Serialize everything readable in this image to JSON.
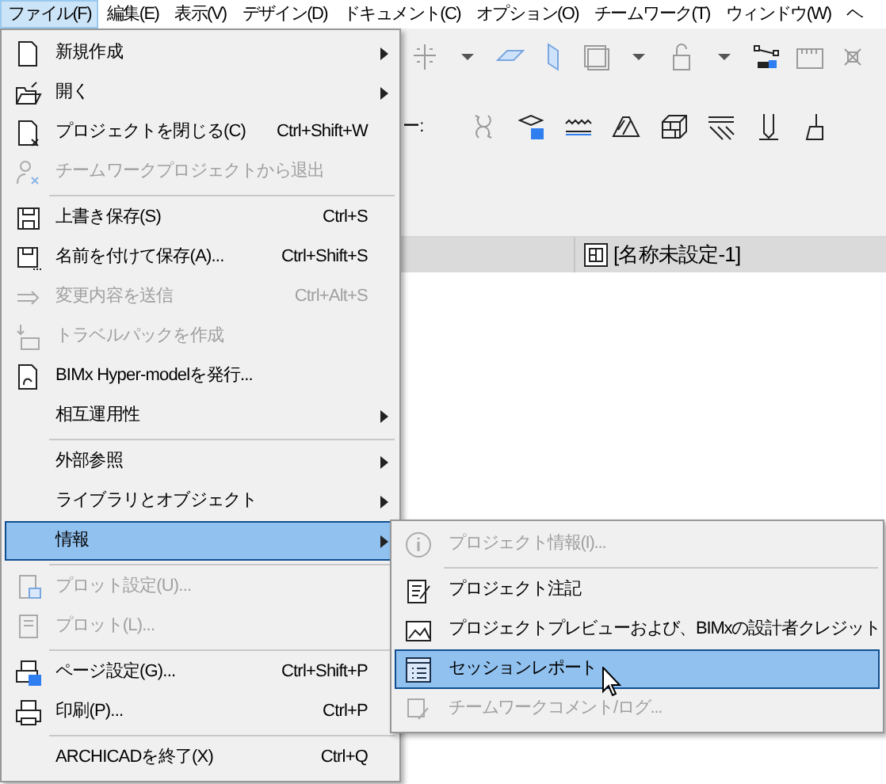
{
  "menubar": [
    {
      "label": "ファイル(F)",
      "selected": true
    },
    {
      "label": "編集(E)",
      "selected": false
    },
    {
      "label": "表示(V)",
      "selected": false
    },
    {
      "label": "デザイン(D)",
      "selected": false
    },
    {
      "label": "ドキュメント(C)",
      "selected": false
    },
    {
      "label": "オプション(O)",
      "selected": false
    },
    {
      "label": "チームワーク(T)",
      "selected": false
    },
    {
      "label": "ウィンドウ(W)",
      "selected": false
    },
    {
      "label": "ヘ",
      "selected": false
    }
  ],
  "toolbar": {
    "label": "ー:"
  },
  "document_tab": {
    "title": "[名称未設定-1]"
  },
  "file_menu": [
    {
      "kind": "item",
      "label": "新規作成",
      "disabled": false,
      "submenu": true,
      "selected": false
    },
    {
      "kind": "item",
      "label": "開く",
      "disabled": false,
      "submenu": true,
      "selected": false
    },
    {
      "kind": "item",
      "label": "プロジェクトを閉じる(C)",
      "shortcut": "Ctrl+Shift+W",
      "disabled": false,
      "submenu": false,
      "selected": false
    },
    {
      "kind": "item",
      "label": "チームワークプロジェクトから退出",
      "disabled": true,
      "submenu": false,
      "selected": false
    },
    {
      "kind": "separator"
    },
    {
      "kind": "item",
      "label": "上書き保存(S)",
      "shortcut": "Ctrl+S",
      "disabled": false,
      "submenu": false,
      "selected": false
    },
    {
      "kind": "item",
      "label": "名前を付けて保存(A)...",
      "shortcut": "Ctrl+Shift+S",
      "disabled": false,
      "submenu": false,
      "selected": false
    },
    {
      "kind": "item",
      "label": "変更内容を送信",
      "shortcut": "Ctrl+Alt+S",
      "disabled": true,
      "submenu": false,
      "selected": false
    },
    {
      "kind": "item",
      "label": "トラベルパックを作成",
      "disabled": true,
      "submenu": false,
      "selected": false
    },
    {
      "kind": "item",
      "label": "BIMx Hyper-modelを発行...",
      "disabled": false,
      "submenu": false,
      "selected": false
    },
    {
      "kind": "item",
      "label": "相互運用性",
      "disabled": false,
      "submenu": true,
      "selected": false
    },
    {
      "kind": "separator"
    },
    {
      "kind": "item",
      "label": "外部参照",
      "disabled": false,
      "submenu": true,
      "selected": false
    },
    {
      "kind": "item",
      "label": "ライブラリとオブジェクト",
      "disabled": false,
      "submenu": true,
      "selected": false
    },
    {
      "kind": "item",
      "label": "情報",
      "disabled": false,
      "submenu": true,
      "selected": true
    },
    {
      "kind": "separator"
    },
    {
      "kind": "item",
      "label": "プロット設定(U)...",
      "disabled": true,
      "submenu": false,
      "selected": false
    },
    {
      "kind": "item",
      "label": "プロット(L)...",
      "disabled": true,
      "submenu": false,
      "selected": false
    },
    {
      "kind": "separator"
    },
    {
      "kind": "item",
      "label": "ページ設定(G)...",
      "shortcut": "Ctrl+Shift+P",
      "disabled": false,
      "submenu": false,
      "selected": false
    },
    {
      "kind": "item",
      "label": "印刷(P)...",
      "shortcut": "Ctrl+P",
      "disabled": false,
      "submenu": false,
      "selected": false
    },
    {
      "kind": "separator"
    },
    {
      "kind": "item",
      "label": "ARCHICADを終了(X)",
      "shortcut": "Ctrl+Q",
      "disabled": false,
      "submenu": false,
      "selected": false
    }
  ],
  "info_submenu": [
    {
      "kind": "item",
      "label": "プロジェクト情報(I)...",
      "disabled": true,
      "selected": false
    },
    {
      "kind": "separator"
    },
    {
      "kind": "item",
      "label": "プロジェクト注記",
      "disabled": false,
      "selected": false
    },
    {
      "kind": "item",
      "label": "プロジェクトプレビューおよび、BIMxの設計者クレジット",
      "disabled": false,
      "selected": false
    },
    {
      "kind": "item",
      "label": "セッションレポート",
      "disabled": false,
      "selected": true
    },
    {
      "kind": "item",
      "label": "チームワークコメント/ログ...",
      "disabled": true,
      "selected": false
    }
  ]
}
